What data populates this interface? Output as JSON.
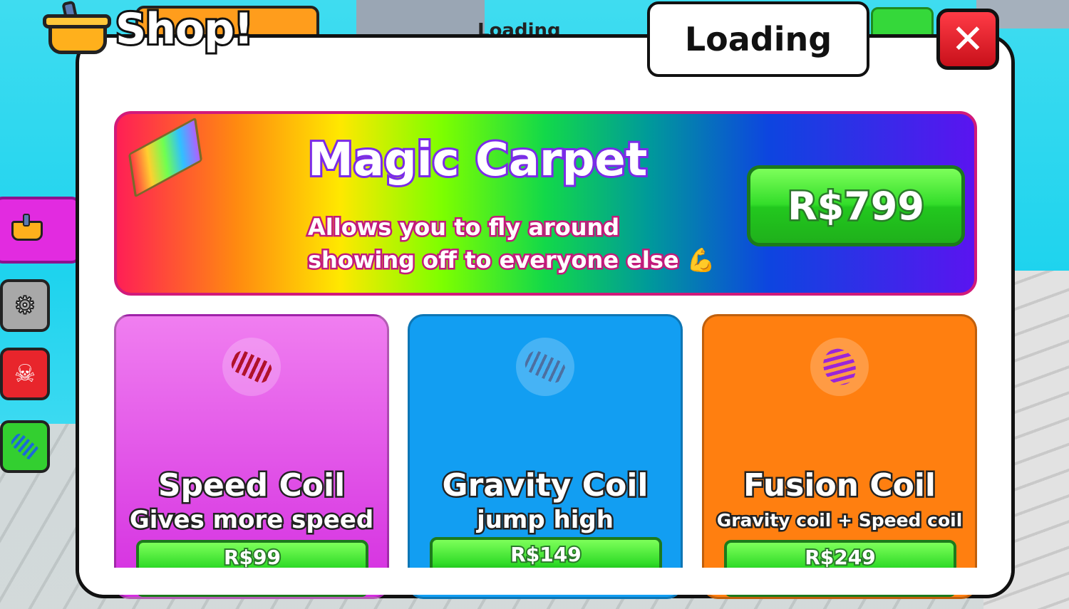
{
  "background": {
    "loading_text": "Loading"
  },
  "header": {
    "title": "Shop!",
    "loading_label": "Loading",
    "close_label": "✕"
  },
  "side_menu": {
    "shop_icon": "basket-icon",
    "settings_icon": "gear-icon",
    "reset_icon": "skull-icon",
    "coil_icon": "coil-icon"
  },
  "featured": {
    "title": "Magic Carpet",
    "description_line1": "Allows you to fly around",
    "description_line2": "showing off to everyone else 💪",
    "price": "R$799",
    "icon": "magic-carpet-icon"
  },
  "products": [
    {
      "name": "Speed Coil",
      "description": "Gives more speed",
      "price": "R$99",
      "icon": "red-coil-icon",
      "color": "#e040e6"
    },
    {
      "name": "Gravity Coil",
      "description": "jump high",
      "price": "R$149",
      "icon": "blue-coil-icon",
      "color": "#129ef2"
    },
    {
      "name": "Fusion Coil",
      "description": "Gravity coil + Speed coil",
      "price": "R$249",
      "icon": "purple-coil-icon",
      "color": "#ff7f10"
    }
  ],
  "colors": {
    "buy_green": "#33dd2a",
    "close_red": "#e8252c"
  }
}
